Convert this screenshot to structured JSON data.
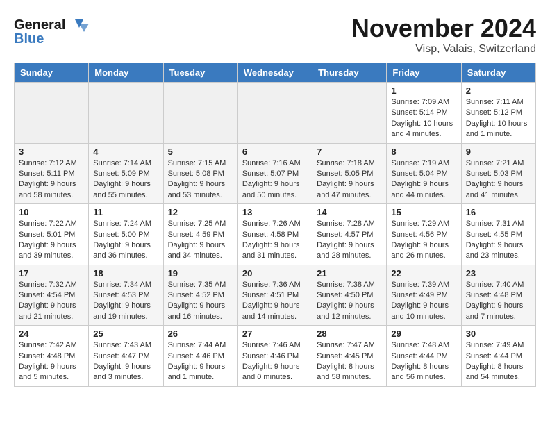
{
  "header": {
    "logo_line1": "General",
    "logo_line2": "Blue",
    "month": "November 2024",
    "location": "Visp, Valais, Switzerland"
  },
  "days_of_week": [
    "Sunday",
    "Monday",
    "Tuesday",
    "Wednesday",
    "Thursday",
    "Friday",
    "Saturday"
  ],
  "weeks": [
    [
      {
        "day": "",
        "info": ""
      },
      {
        "day": "",
        "info": ""
      },
      {
        "day": "",
        "info": ""
      },
      {
        "day": "",
        "info": ""
      },
      {
        "day": "",
        "info": ""
      },
      {
        "day": "1",
        "info": "Sunrise: 7:09 AM\nSunset: 5:14 PM\nDaylight: 10 hours and 4 minutes."
      },
      {
        "day": "2",
        "info": "Sunrise: 7:11 AM\nSunset: 5:12 PM\nDaylight: 10 hours and 1 minute."
      }
    ],
    [
      {
        "day": "3",
        "info": "Sunrise: 7:12 AM\nSunset: 5:11 PM\nDaylight: 9 hours and 58 minutes."
      },
      {
        "day": "4",
        "info": "Sunrise: 7:14 AM\nSunset: 5:09 PM\nDaylight: 9 hours and 55 minutes."
      },
      {
        "day": "5",
        "info": "Sunrise: 7:15 AM\nSunset: 5:08 PM\nDaylight: 9 hours and 53 minutes."
      },
      {
        "day": "6",
        "info": "Sunrise: 7:16 AM\nSunset: 5:07 PM\nDaylight: 9 hours and 50 minutes."
      },
      {
        "day": "7",
        "info": "Sunrise: 7:18 AM\nSunset: 5:05 PM\nDaylight: 9 hours and 47 minutes."
      },
      {
        "day": "8",
        "info": "Sunrise: 7:19 AM\nSunset: 5:04 PM\nDaylight: 9 hours and 44 minutes."
      },
      {
        "day": "9",
        "info": "Sunrise: 7:21 AM\nSunset: 5:03 PM\nDaylight: 9 hours and 41 minutes."
      }
    ],
    [
      {
        "day": "10",
        "info": "Sunrise: 7:22 AM\nSunset: 5:01 PM\nDaylight: 9 hours and 39 minutes."
      },
      {
        "day": "11",
        "info": "Sunrise: 7:24 AM\nSunset: 5:00 PM\nDaylight: 9 hours and 36 minutes."
      },
      {
        "day": "12",
        "info": "Sunrise: 7:25 AM\nSunset: 4:59 PM\nDaylight: 9 hours and 34 minutes."
      },
      {
        "day": "13",
        "info": "Sunrise: 7:26 AM\nSunset: 4:58 PM\nDaylight: 9 hours and 31 minutes."
      },
      {
        "day": "14",
        "info": "Sunrise: 7:28 AM\nSunset: 4:57 PM\nDaylight: 9 hours and 28 minutes."
      },
      {
        "day": "15",
        "info": "Sunrise: 7:29 AM\nSunset: 4:56 PM\nDaylight: 9 hours and 26 minutes."
      },
      {
        "day": "16",
        "info": "Sunrise: 7:31 AM\nSunset: 4:55 PM\nDaylight: 9 hours and 23 minutes."
      }
    ],
    [
      {
        "day": "17",
        "info": "Sunrise: 7:32 AM\nSunset: 4:54 PM\nDaylight: 9 hours and 21 minutes."
      },
      {
        "day": "18",
        "info": "Sunrise: 7:34 AM\nSunset: 4:53 PM\nDaylight: 9 hours and 19 minutes."
      },
      {
        "day": "19",
        "info": "Sunrise: 7:35 AM\nSunset: 4:52 PM\nDaylight: 9 hours and 16 minutes."
      },
      {
        "day": "20",
        "info": "Sunrise: 7:36 AM\nSunset: 4:51 PM\nDaylight: 9 hours and 14 minutes."
      },
      {
        "day": "21",
        "info": "Sunrise: 7:38 AM\nSunset: 4:50 PM\nDaylight: 9 hours and 12 minutes."
      },
      {
        "day": "22",
        "info": "Sunrise: 7:39 AM\nSunset: 4:49 PM\nDaylight: 9 hours and 10 minutes."
      },
      {
        "day": "23",
        "info": "Sunrise: 7:40 AM\nSunset: 4:48 PM\nDaylight: 9 hours and 7 minutes."
      }
    ],
    [
      {
        "day": "24",
        "info": "Sunrise: 7:42 AM\nSunset: 4:48 PM\nDaylight: 9 hours and 5 minutes."
      },
      {
        "day": "25",
        "info": "Sunrise: 7:43 AM\nSunset: 4:47 PM\nDaylight: 9 hours and 3 minutes."
      },
      {
        "day": "26",
        "info": "Sunrise: 7:44 AM\nSunset: 4:46 PM\nDaylight: 9 hours and 1 minute."
      },
      {
        "day": "27",
        "info": "Sunrise: 7:46 AM\nSunset: 4:46 PM\nDaylight: 9 hours and 0 minutes."
      },
      {
        "day": "28",
        "info": "Sunrise: 7:47 AM\nSunset: 4:45 PM\nDaylight: 8 hours and 58 minutes."
      },
      {
        "day": "29",
        "info": "Sunrise: 7:48 AM\nSunset: 4:44 PM\nDaylight: 8 hours and 56 minutes."
      },
      {
        "day": "30",
        "info": "Sunrise: 7:49 AM\nSunset: 4:44 PM\nDaylight: 8 hours and 54 minutes."
      }
    ]
  ]
}
